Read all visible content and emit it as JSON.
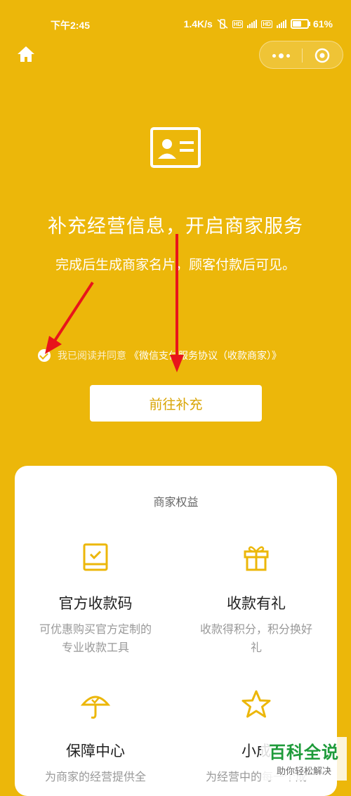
{
  "status_bar": {
    "time": "下午2:45",
    "network_speed": "1.4K/s",
    "battery": "61%"
  },
  "nav": {
    "home_icon": "home-icon",
    "more_icon": "more-dots-icon",
    "close_icon": "target-close-icon"
  },
  "hero": {
    "icon": "id-card-icon",
    "title": "补充经营信息，开启商家服务",
    "subtitle": "完成后生成商家名片，顾客付款后可见。"
  },
  "agreement": {
    "checked": true,
    "prefix": "我已阅读并同意",
    "link": "《微信支付服务协议（收款商家）》"
  },
  "cta": {
    "label": "前往补充"
  },
  "benefits": {
    "title": "商家权益",
    "items": [
      {
        "icon": "qr-badge-icon",
        "title": "官方收款码",
        "desc": "可优惠购买官方定制的专业收款工具"
      },
      {
        "icon": "gift-icon",
        "title": "收款有礼",
        "desc": "收款得积分，积分换好礼"
      },
      {
        "icon": "umbrella-icon",
        "title": "保障中心",
        "desc": "为商家的经营提供全"
      },
      {
        "icon": "star-icon",
        "title": "小成",
        "desc": "为经营中的每一个成"
      }
    ]
  },
  "watermark": {
    "main": "百科全说",
    "sub": "助你轻松解决"
  },
  "colors": {
    "background": "#ECB70A",
    "accent_text": "#D9A505",
    "annotation_arrow": "#E8141B"
  }
}
